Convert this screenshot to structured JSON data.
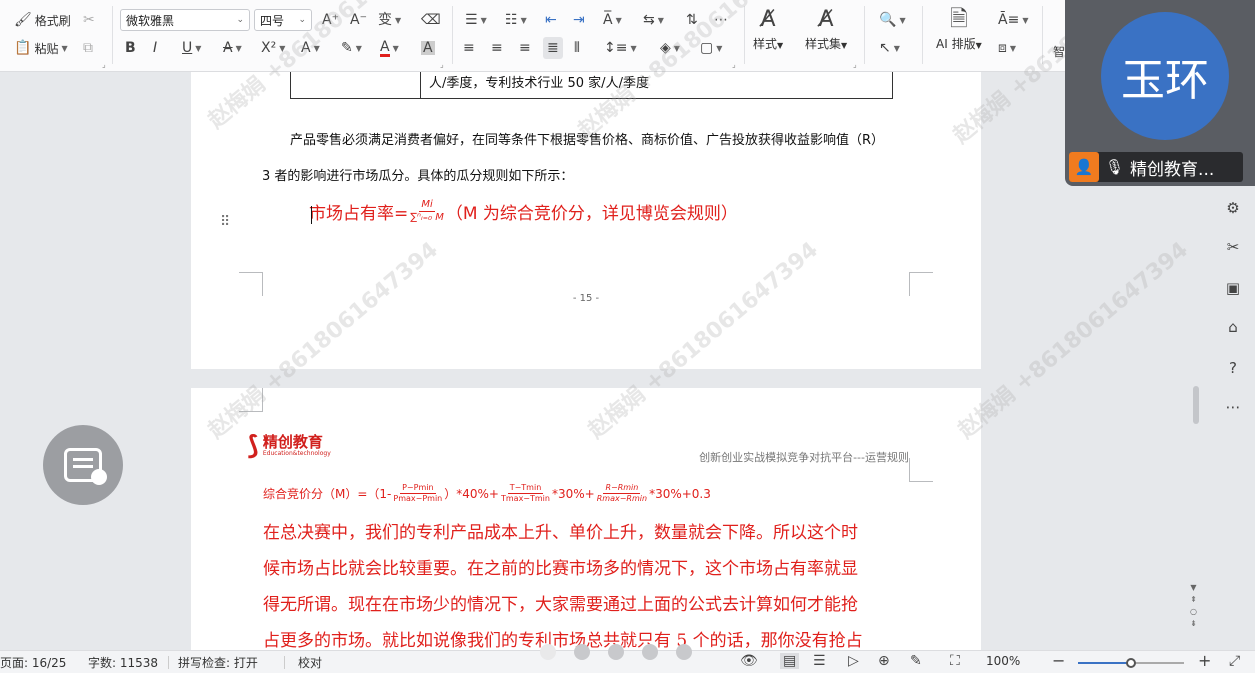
{
  "ribbon": {
    "format_painter": "格式刷",
    "paste": "粘贴",
    "font_name": "微软雅黑",
    "font_size": "四号",
    "styles": "样式",
    "style_sets": "样式集",
    "ai_layout": "AI 排版",
    "smart": "智"
  },
  "document": {
    "table_text": "人/季度，专利技术行业 50 家/人/季度",
    "para1_line1": "产品零售必须满足消费者偏好，在同等条件下根据零售价格、商标价值、广告投放获得收益影响值（R）",
    "para1_line2": "3 者的影响进行市场瓜分。具体的瓜分规则如下所示：",
    "formula1_label": "市场占有率=",
    "formula1_num": "Mi",
    "formula1_den": "∑ⁿᵢ₌₀ M",
    "formula1_note": "（M 为综合竞价分，详见博览会规则）",
    "page_number": "- 15 -",
    "logo_cn": "精创教育",
    "logo_en": "Education&technology",
    "header_right": "创新创业实战模拟竞争对抗平台---运营规则",
    "formula2_label": "综合竞价分（M）=（1-",
    "formula2_f1_num": "P−Pmin",
    "formula2_f1_den": "Pmax−Pmin",
    "formula2_mid1": "）*40%+",
    "formula2_f2_num": "T−Tmin",
    "formula2_f2_den": "Tmax−Tmin",
    "formula2_mid2": "*30%+",
    "formula2_f3_num": "R−Rmin",
    "formula2_f3_den": "Rmax−Rmin",
    "formula2_tail": "*30%+0.3",
    "body_lines": [
      "在总决赛中，我们的专利产品成本上升、单价上升，数量就会下降。所以这个时",
      "候市场占比就会比较重要。在之前的比赛市场多的情况下，这个市场占有率就显",
      "得无所谓。现在在市场少的情况下，大家需要通过上面的公式去计算如何才能抢",
      "占更多的市场。就比如说像我们的专利市场总共就只有 5 个的话，那你没有抢占"
    ],
    "watermark": "赵梅娟 +8618061647394"
  },
  "video": {
    "avatar_text": "玉环",
    "participant_name": "精创教育..."
  },
  "status": {
    "page": "页面: 16/25",
    "words": "字数: 11538",
    "spellcheck": "拼写检查: 打开",
    "proofread": "校对",
    "zoom": "100%",
    "zoom_level": 0.5
  },
  "colors": {
    "accent_red": "#e0201c",
    "avatar_blue": "#3a72c4",
    "user_orange": "#f07b1f"
  }
}
